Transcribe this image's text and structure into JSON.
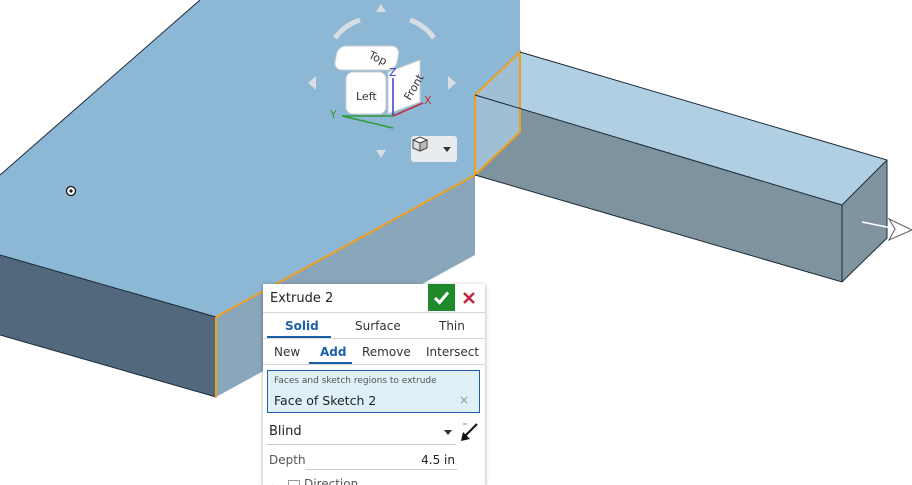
{
  "view_cube": {
    "faces": {
      "top": "Top",
      "left": "Left",
      "front": "Front"
    },
    "axes": {
      "x": "X",
      "y": "Y",
      "z": "Z"
    },
    "view_menu_icon": "cube-view-icon"
  },
  "feature_dialog": {
    "title": "Extrude 2",
    "accept_icon": "checkmark-icon",
    "cancel_icon": "close-icon",
    "body_types": [
      {
        "label": "Solid",
        "active": true
      },
      {
        "label": "Surface",
        "active": false
      },
      {
        "label": "Thin",
        "active": false
      }
    ],
    "operations": [
      {
        "label": "New",
        "active": false
      },
      {
        "label": "Add",
        "active": true
      },
      {
        "label": "Remove",
        "active": false
      },
      {
        "label": "Intersect",
        "active": false
      }
    ],
    "selection": {
      "hint": "Faces and sketch regions to extrude",
      "value": "Face of Sketch 2",
      "clear_symbol": "×"
    },
    "end_type": "Blind",
    "depth_label": "Depth",
    "depth_value": "4.5 in",
    "direction_label": "Direction"
  },
  "colors": {
    "accent": "#1b5fa8",
    "accept": "#1f8a2c",
    "cancel": "#c0283d",
    "top_face": "#8ab5d3",
    "side_face": "#607a8f",
    "highlight_edge": "#f0a020"
  }
}
